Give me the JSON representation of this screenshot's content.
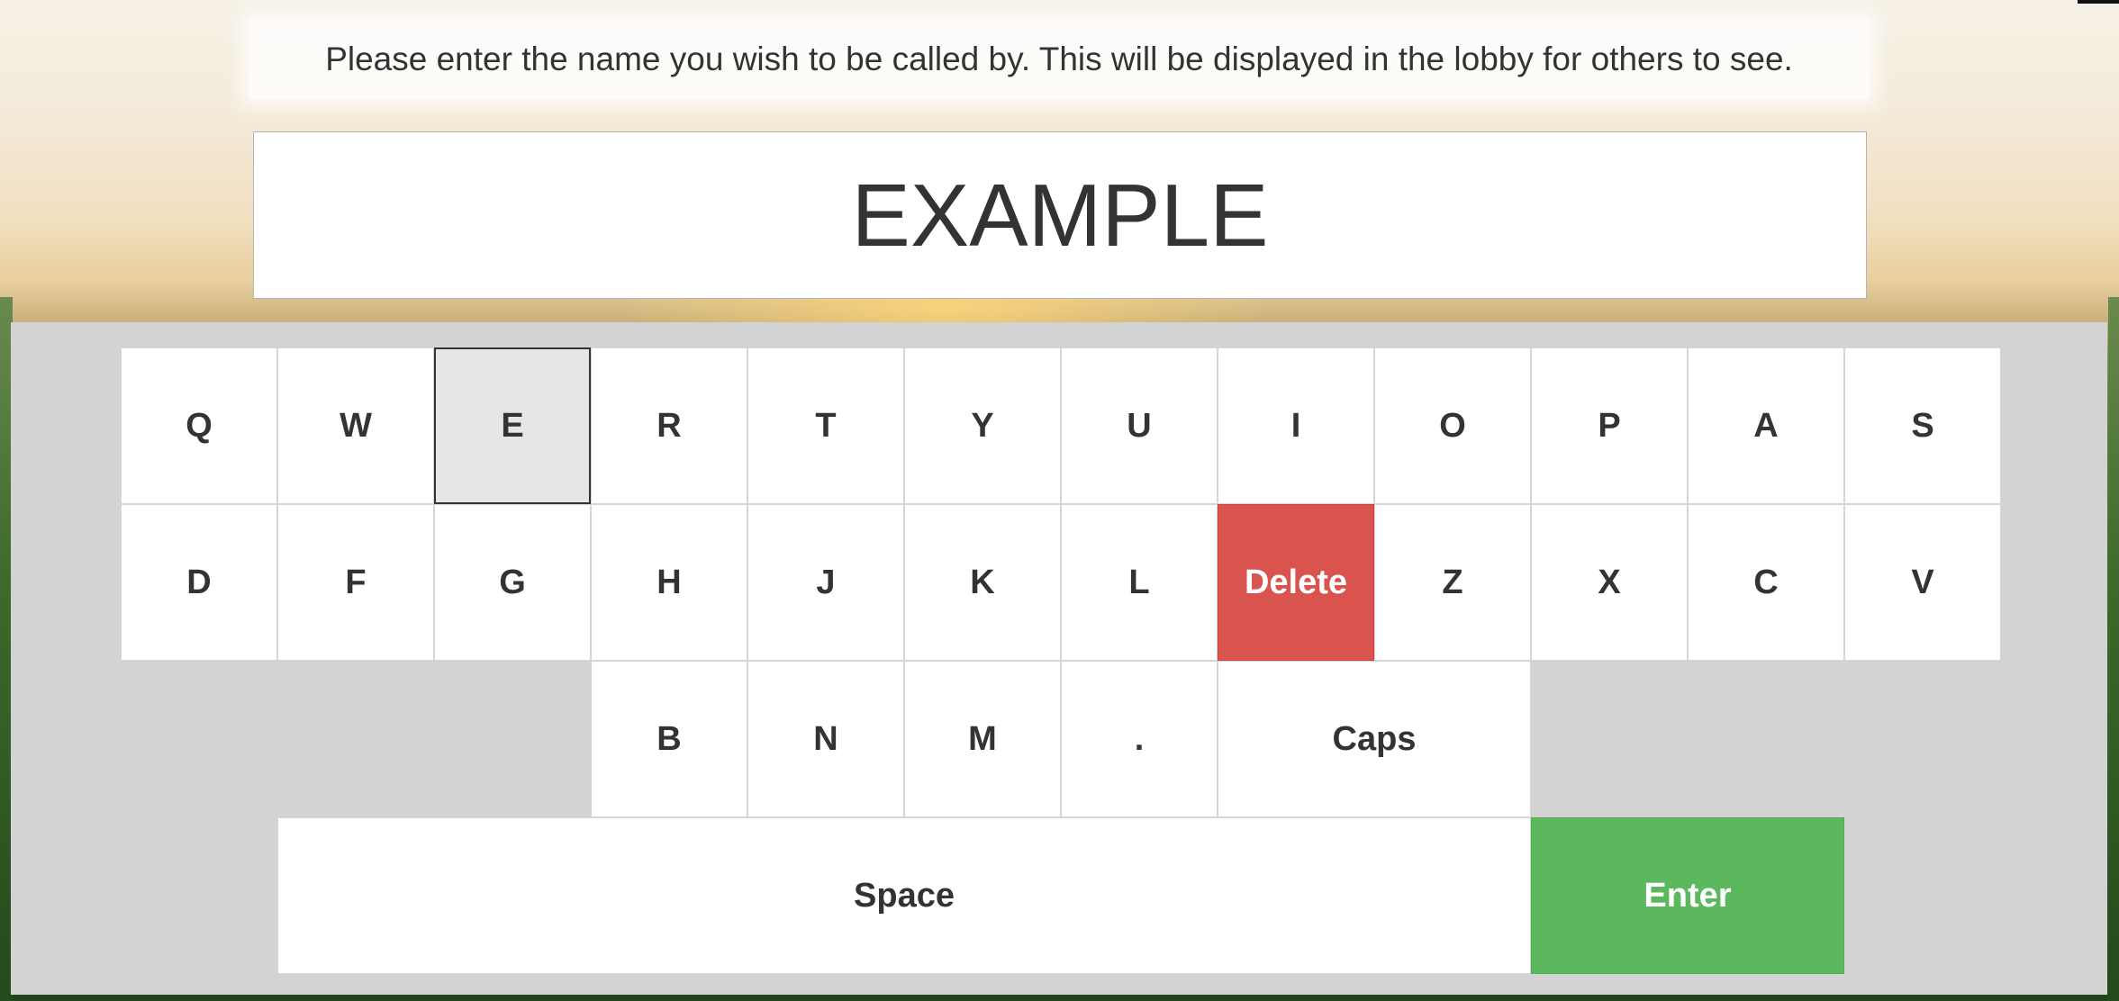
{
  "prompt": {
    "text": "Please enter the name you wish to be called by. This will be displayed in the lobby for others to see."
  },
  "name_input": {
    "value": "EXAMPLE"
  },
  "keyboard": {
    "row1": [
      "Q",
      "W",
      "E",
      "R",
      "T",
      "Y",
      "U",
      "I",
      "O",
      "P",
      "A",
      "S"
    ],
    "row2": [
      "D",
      "F",
      "G",
      "H",
      "J",
      "K",
      "L",
      "Delete",
      "Z",
      "X",
      "C",
      "V"
    ],
    "row3": [
      "B",
      "N",
      "M",
      ".",
      "Caps"
    ],
    "row4": [
      "Space",
      "Enter"
    ],
    "focused_key": "E"
  },
  "colors": {
    "delete": "#d9534f",
    "enter": "#5cb85c",
    "keyboard_background": "#d3d3d3",
    "key_background": "#ffffff",
    "focused_key_background": "#e6e6e6"
  }
}
